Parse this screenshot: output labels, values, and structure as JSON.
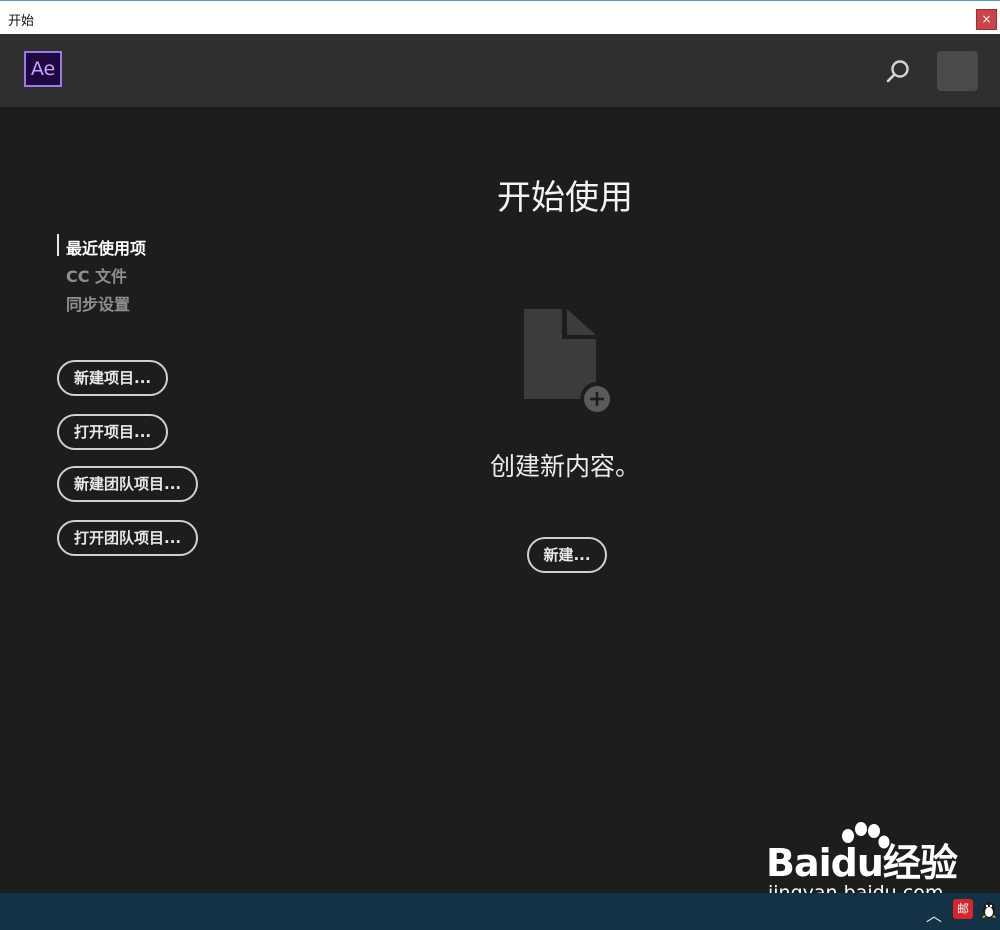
{
  "window": {
    "title": "开始",
    "close_glyph": "×"
  },
  "header": {
    "logo_text": "Ae",
    "icons": [
      "search-icon"
    ]
  },
  "nav": {
    "items": [
      {
        "label": "最近使用项",
        "active": true
      },
      {
        "label": "CC 文件",
        "active": false
      },
      {
        "label": "同步设置",
        "active": false
      }
    ]
  },
  "actions": {
    "buttons": [
      {
        "label": "新建项目..."
      },
      {
        "label": "打开项目..."
      },
      {
        "label": "新建团队项目..."
      },
      {
        "label": "打开团队项目..."
      }
    ]
  },
  "main": {
    "title": "开始使用",
    "subtitle": "创建新内容。",
    "new_button": "新建..."
  },
  "watermark": {
    "brand": "Baidu经验",
    "url": "jingyan.baidu.com"
  },
  "taskbar": {
    "chevron": "︿",
    "mail_label": "邮"
  },
  "colors": {
    "background": "#1d1d1d",
    "header": "#2f2f2f",
    "ae_logo_bg": "#1f0740",
    "ae_logo_accent": "#9a7be6",
    "taskbar": "#143246",
    "close_button": "#c9444b"
  }
}
